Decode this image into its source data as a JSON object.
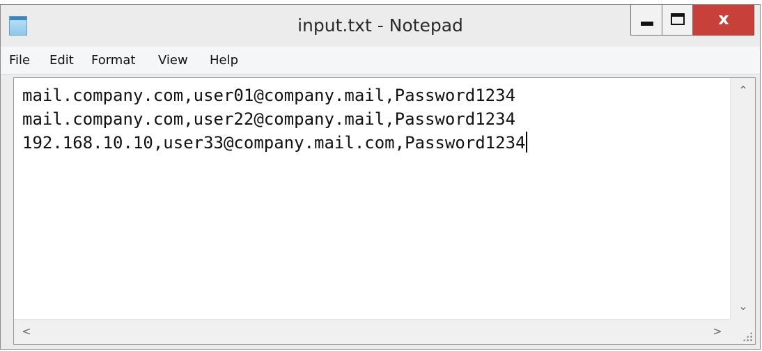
{
  "window": {
    "title": "input.txt - Notepad",
    "close_label": "x"
  },
  "menubar": {
    "items": [
      "File",
      "Edit",
      "Format",
      "View",
      "Help"
    ]
  },
  "editor": {
    "lines": [
      "mail.company.com,user01@company.mail,Password1234",
      "mail.company.com,user22@company.mail,Password1234",
      "192.168.10.10,user33@company.mail.com,Password1234"
    ]
  },
  "icons": {
    "app": "notepad-icon",
    "minimize": "minimize-icon",
    "maximize": "maximize-icon",
    "close": "close-icon",
    "scroll_up": "chevron-up-icon",
    "scroll_down": "chevron-down-icon",
    "scroll_left": "chevron-left-icon",
    "scroll_right": "chevron-right-icon",
    "size_grip": "size-grip-icon"
  },
  "colors": {
    "close_button": "#c7403a",
    "window_chrome": "#ececec"
  }
}
